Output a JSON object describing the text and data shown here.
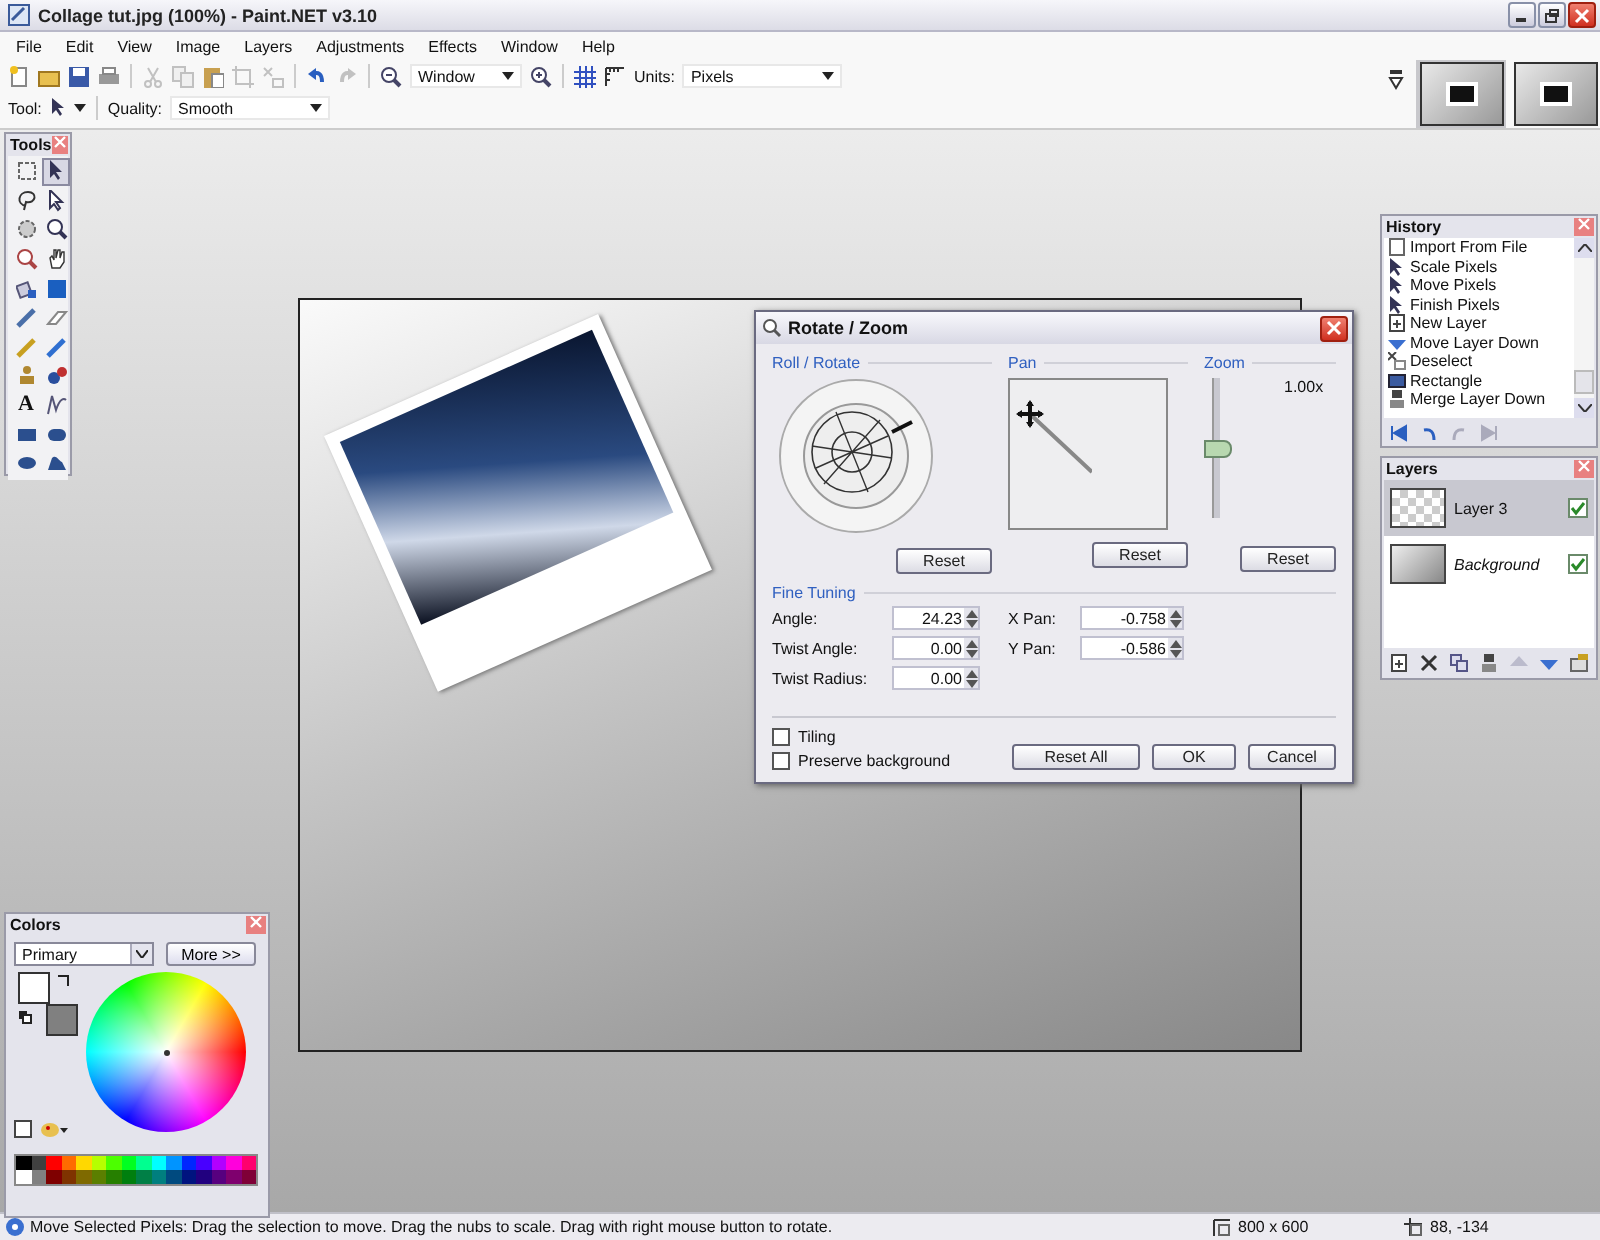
{
  "window": {
    "title": "Collage tut.jpg (100%) - Paint.NET v3.10"
  },
  "menu": [
    "File",
    "Edit",
    "View",
    "Image",
    "Layers",
    "Adjustments",
    "Effects",
    "Window",
    "Help"
  ],
  "toolbar": {
    "zoom": "Window",
    "units_label": "Units:",
    "units": "Pixels"
  },
  "tool_options": {
    "tool_label": "Tool:",
    "quality_label": "Quality:",
    "quality": "Smooth"
  },
  "image_tabs": [
    {
      "selected": true
    },
    {
      "selected": false
    }
  ],
  "tools_panel": {
    "title": "Tools",
    "tools": [
      {
        "kind": "rect-select",
        "selected": false
      },
      {
        "kind": "move-pixels",
        "selected": true
      },
      {
        "kind": "lasso",
        "selected": false
      },
      {
        "kind": "move-selection",
        "selected": false
      },
      {
        "kind": "ellipse-select",
        "selected": false
      },
      {
        "kind": "zoom",
        "selected": false
      },
      {
        "kind": "magic-wand",
        "selected": false
      },
      {
        "kind": "pan",
        "selected": false
      },
      {
        "kind": "bucket",
        "selected": false
      },
      {
        "kind": "gradient",
        "selected": false
      },
      {
        "kind": "brush",
        "selected": false
      },
      {
        "kind": "eraser",
        "selected": false
      },
      {
        "kind": "pencil",
        "selected": false
      },
      {
        "kind": "picker",
        "selected": false
      },
      {
        "kind": "stamp",
        "selected": false
      },
      {
        "kind": "recolor",
        "selected": false
      },
      {
        "kind": "text",
        "glyph": "A",
        "selected": false
      },
      {
        "kind": "line",
        "selected": false
      },
      {
        "kind": "rectangle",
        "selected": false
      },
      {
        "kind": "rounded-rect",
        "selected": false
      },
      {
        "kind": "ellipse",
        "selected": false
      },
      {
        "kind": "freeform",
        "selected": false
      }
    ]
  },
  "history": {
    "title": "History",
    "items": [
      {
        "kind": "import",
        "label": "Import From File"
      },
      {
        "kind": "pixels",
        "label": "Scale Pixels"
      },
      {
        "kind": "pixels",
        "label": "Move Pixels"
      },
      {
        "kind": "pixels",
        "label": "Finish Pixels"
      },
      {
        "kind": "new-layer",
        "label": "New Layer"
      },
      {
        "kind": "layer-down",
        "label": "Move Layer Down"
      },
      {
        "kind": "deselect",
        "label": "Deselect"
      },
      {
        "kind": "rectangle",
        "label": "Rectangle"
      },
      {
        "kind": "merge",
        "label": "Merge Layer Down"
      }
    ]
  },
  "layers": {
    "title": "Layers",
    "items": [
      {
        "name": "Layer 3",
        "is_background": false,
        "selected": true,
        "visible": true
      },
      {
        "name": "Background",
        "is_background": true,
        "selected": false,
        "visible": true
      }
    ]
  },
  "colors": {
    "title": "Colors",
    "mode": "Primary",
    "more_button": "More >>",
    "swatches": [
      {
        "color": "#ffffff"
      },
      {
        "color": "#808080"
      }
    ],
    "palette": [
      {
        "color": "#000000"
      },
      {
        "color": "#404040"
      },
      {
        "color": "#ff0000"
      },
      {
        "color": "#ff6a00"
      },
      {
        "color": "#ffd800"
      },
      {
        "color": "#b6ff00"
      },
      {
        "color": "#4cff00"
      },
      {
        "color": "#00ff21"
      },
      {
        "color": "#00ff90"
      },
      {
        "color": "#00ffff"
      },
      {
        "color": "#0094ff"
      },
      {
        "color": "#0026ff"
      },
      {
        "color": "#4800ff"
      },
      {
        "color": "#b200ff"
      },
      {
        "color": "#ff00dc"
      },
      {
        "color": "#ff006e"
      },
      {
        "color": "#ffffff"
      },
      {
        "color": "#808080"
      },
      {
        "color": "#7f0000"
      },
      {
        "color": "#7f3300"
      },
      {
        "color": "#7f6a00"
      },
      {
        "color": "#5b7f00"
      },
      {
        "color": "#267f00"
      },
      {
        "color": "#007f0e"
      },
      {
        "color": "#007f46"
      },
      {
        "color": "#007f7f"
      },
      {
        "color": "#004a7f"
      },
      {
        "color": "#00137f"
      },
      {
        "color": "#21007f"
      },
      {
        "color": "#57007f"
      },
      {
        "color": "#7f006e"
      },
      {
        "color": "#7f0037"
      }
    ]
  },
  "dialog": {
    "title": "Rotate / Zoom",
    "roll_label": "Roll / Rotate",
    "pan_label": "Pan",
    "zoom_label": "Zoom",
    "zoom_value": "1.00x",
    "zoom": {
      "level": 0.5
    },
    "reset_buttons": [
      "Reset",
      "Reset",
      "Reset"
    ],
    "fine_tuning_label": "Fine Tuning",
    "fields_left": [
      {
        "label": "Angle:",
        "value": "24.23"
      },
      {
        "label": "Twist Angle:",
        "value": "0.00"
      },
      {
        "label": "Twist Radius:",
        "value": "0.00"
      }
    ],
    "fields_right": [
      {
        "label": "X Pan:",
        "value": "-0.758"
      },
      {
        "label": "Y Pan:",
        "value": "-0.586"
      }
    ],
    "checkboxes": [
      {
        "label": "Tiling",
        "checked": false
      },
      {
        "label": "Preserve background",
        "checked": false
      }
    ],
    "buttons": [
      "Reset All",
      "OK",
      "Cancel"
    ]
  },
  "status_bar": {
    "message": "Move Selected Pixels: Drag the selection to move. Drag the nubs to scale. Drag with right mouse button to rotate.",
    "size": "800 x 600",
    "position": "88, -134"
  }
}
